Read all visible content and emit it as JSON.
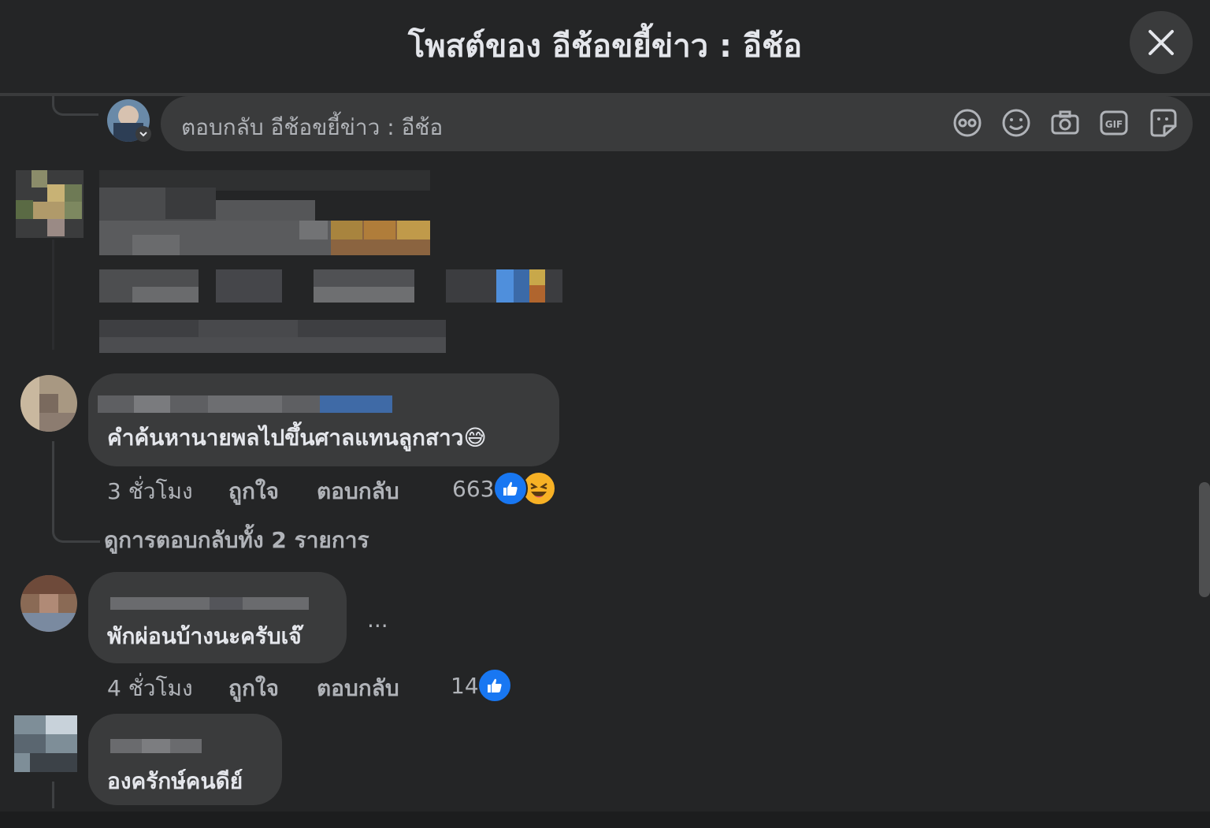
{
  "header": {
    "title": "โพสต์ของ อีช้อขยี้ข่าว : อีช้อ"
  },
  "reply_box": {
    "placeholder": "ตอบกลับ อีช้อขยี้ข่าว : อีช้อ",
    "icons": [
      "avatar-sticker-icon",
      "emoji-icon",
      "camera-icon",
      "gif-icon",
      "sticker-icon"
    ]
  },
  "comments": [
    {
      "text": "คำค้นหานายพลไปขึ้นศาลแทนลูกสาว",
      "emoji": "😅",
      "time": "3 ชั่วโมง",
      "like_label": "ถูกใจ",
      "reply_label": "ตอบกลับ",
      "reaction_count": "663",
      "view_replies": "ดูการตอบกลับทั้ง 2 รายการ"
    },
    {
      "text": "พักผ่อนบ้างนะครับเจ๊",
      "more": "...",
      "time": "4 ชั่วโมง",
      "like_label": "ถูกใจ",
      "reply_label": "ตอบกลับ",
      "reaction_count": "14"
    },
    {
      "text": "องครักษ์คนดีย์"
    }
  ],
  "colors": {
    "background": "#242526",
    "bubble": "#3a3b3c",
    "like_blue": "#1877f2",
    "muted_text": "#b0b3b8"
  }
}
